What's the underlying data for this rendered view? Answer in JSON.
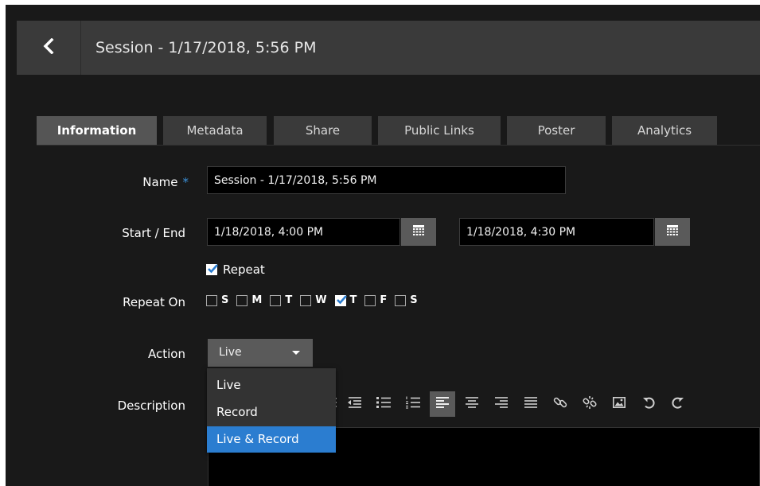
{
  "header": {
    "title": "Session - 1/17/2018, 5:56 PM",
    "back_icon": "chevron-left-icon"
  },
  "tabs": [
    {
      "label": "Information",
      "active": true
    },
    {
      "label": "Metadata",
      "active": false
    },
    {
      "label": "Share",
      "active": false
    },
    {
      "label": "Public Links",
      "active": false
    },
    {
      "label": "Poster",
      "active": false
    },
    {
      "label": "Analytics",
      "active": false
    }
  ],
  "form": {
    "name_label": "Name",
    "required_marker": "*",
    "name_value": "Session - 1/17/2018, 5:56 PM",
    "start_end_label": "Start / End",
    "start_value": "1/18/2018, 4:00 PM",
    "end_value": "1/18/2018, 4:30 PM",
    "calendar_icon": "calendar-icon",
    "repeat_label": "Repeat",
    "repeat_checked": true,
    "repeat_on_label": "Repeat On",
    "days": [
      {
        "label": "S",
        "checked": false
      },
      {
        "label": "M",
        "checked": false
      },
      {
        "label": "T",
        "checked": false
      },
      {
        "label": "W",
        "checked": false
      },
      {
        "label": "T",
        "checked": true
      },
      {
        "label": "F",
        "checked": false
      },
      {
        "label": "S",
        "checked": false
      }
    ],
    "action_label": "Action",
    "action_value": "Live",
    "action_options": [
      "Live",
      "Record",
      "Live & Record"
    ],
    "action_highlighted": "Live & Record",
    "description_label": "Description"
  },
  "toolbar": {
    "icons": [
      "align-justify-icon",
      "outdent-icon",
      "bulleted-list-icon",
      "numbered-list-icon",
      "align-left-icon",
      "align-center-icon",
      "align-right-icon",
      "align-full-icon",
      "link-icon",
      "unlink-icon",
      "image-icon",
      "undo-icon",
      "redo-icon"
    ],
    "active_icon": "align-left-icon"
  },
  "colors": {
    "background": "#191919",
    "header": "#3a3a3a",
    "accent": "#2b7dd0",
    "required": "#3b8fd6"
  }
}
